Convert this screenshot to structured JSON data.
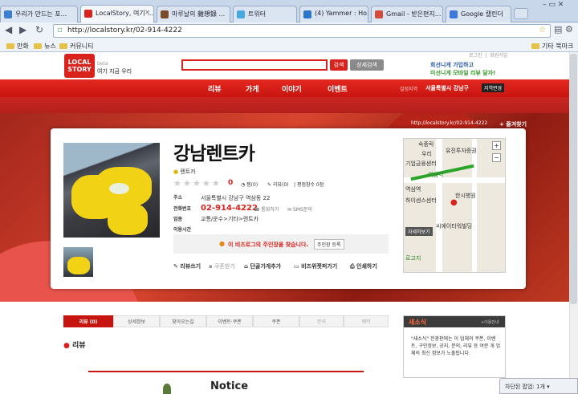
{
  "tabs": [
    {
      "label": "우리가 만드는 포...",
      "color": "#3b7fd1"
    },
    {
      "label": "LocalStory, 여기 ...",
      "color": "#d9221c"
    },
    {
      "label": "마루날의 雜想錄 ...",
      "color": "#7a4b2a"
    },
    {
      "label": "트위터",
      "color": "#4aa8e0"
    },
    {
      "label": "(4) Yammer : Ho...",
      "color": "#2a76c9"
    },
    {
      "label": "Gmail - 받은편지...",
      "color": "#d64a3a"
    },
    {
      "label": "Google 캘린더",
      "color": "#3c78d8"
    }
  ],
  "address": "http://localstory.kr/02-914-4222",
  "bookmarks": [
    "만화",
    "뉴스",
    "커뮤니티"
  ],
  "other_bookmarks": "기타 북마크",
  "site": {
    "logo_line1": "LOCAL",
    "logo_line2": "STORY",
    "logo_beta": "beta",
    "tagline": "여기 지금 우리",
    "search_btn": "검색",
    "detail_btn": "상세검색",
    "login": "로그인",
    "join": "회원가입",
    "banner_line1": "회선니게 가입하고",
    "banner_line2": "미선니게 모바일 리뷰 달자!",
    "nav": [
      "리뷰",
      "가게",
      "이야기",
      "이벤트"
    ],
    "region_label": "설정지역",
    "region_value": "서울특별시 강남구",
    "region_btn": "지역변경"
  },
  "store": {
    "url": "http://localstory.kr/02-914-4222",
    "subscribe": "+ 즐겨찾기",
    "name": "강남렌트카",
    "category": "렌트카",
    "rating": "0",
    "rating_stars": 0,
    "stats": [
      "찜(0)",
      "리뷰(0)",
      "평점참수 0점"
    ],
    "address_label": "주소",
    "address": "서울특별시 강남구 역삼동 22",
    "phone_label": "전화번호",
    "phone": "02-914-4222",
    "call": "통화하기",
    "sms": "SMS문의",
    "biz_label": "업종",
    "biz": "교통/운수>기타>렌트카",
    "hours_label": "이용시간",
    "owner_msg": "이 비즈로그의 주인장을 찾습니다.",
    "owner_btn": "주인장 등록",
    "actions": [
      "리뷰쓰기",
      "쿠폰받기",
      "단골가게추가",
      "비즈위젯퍼가기",
      "인쇄하기"
    ]
  },
  "map": {
    "labels": [
      "숙중릭",
      "우리",
      "유진투자증권",
      "기업금융센터",
      "역삼역",
      "역삼역",
      "하이센스센터",
      "한시병원",
      "씨에이타워빌딩",
      "자세히보기",
      "로고지"
    ],
    "zoom_in": "+",
    "zoom_out": "−"
  },
  "content_tabs": [
    "리뷰 (0)",
    "상세정보",
    "찾아오는길",
    "이벤트·쿠폰",
    "쿠폰",
    "문의",
    "예약"
  ],
  "review_header": "리뷰",
  "notice": "Notice",
  "news": {
    "title": "새소식",
    "more": "+이용안내",
    "body": "\"새소식\" 전광판에는 이 업체의 쿠폰, 이벤트, 구인정보, 공지, 문의, 리뷰 등 여분 개 업체의 최신 정보가 노출됩니다."
  },
  "popup": "차단된 팝업: 1개 ▾"
}
